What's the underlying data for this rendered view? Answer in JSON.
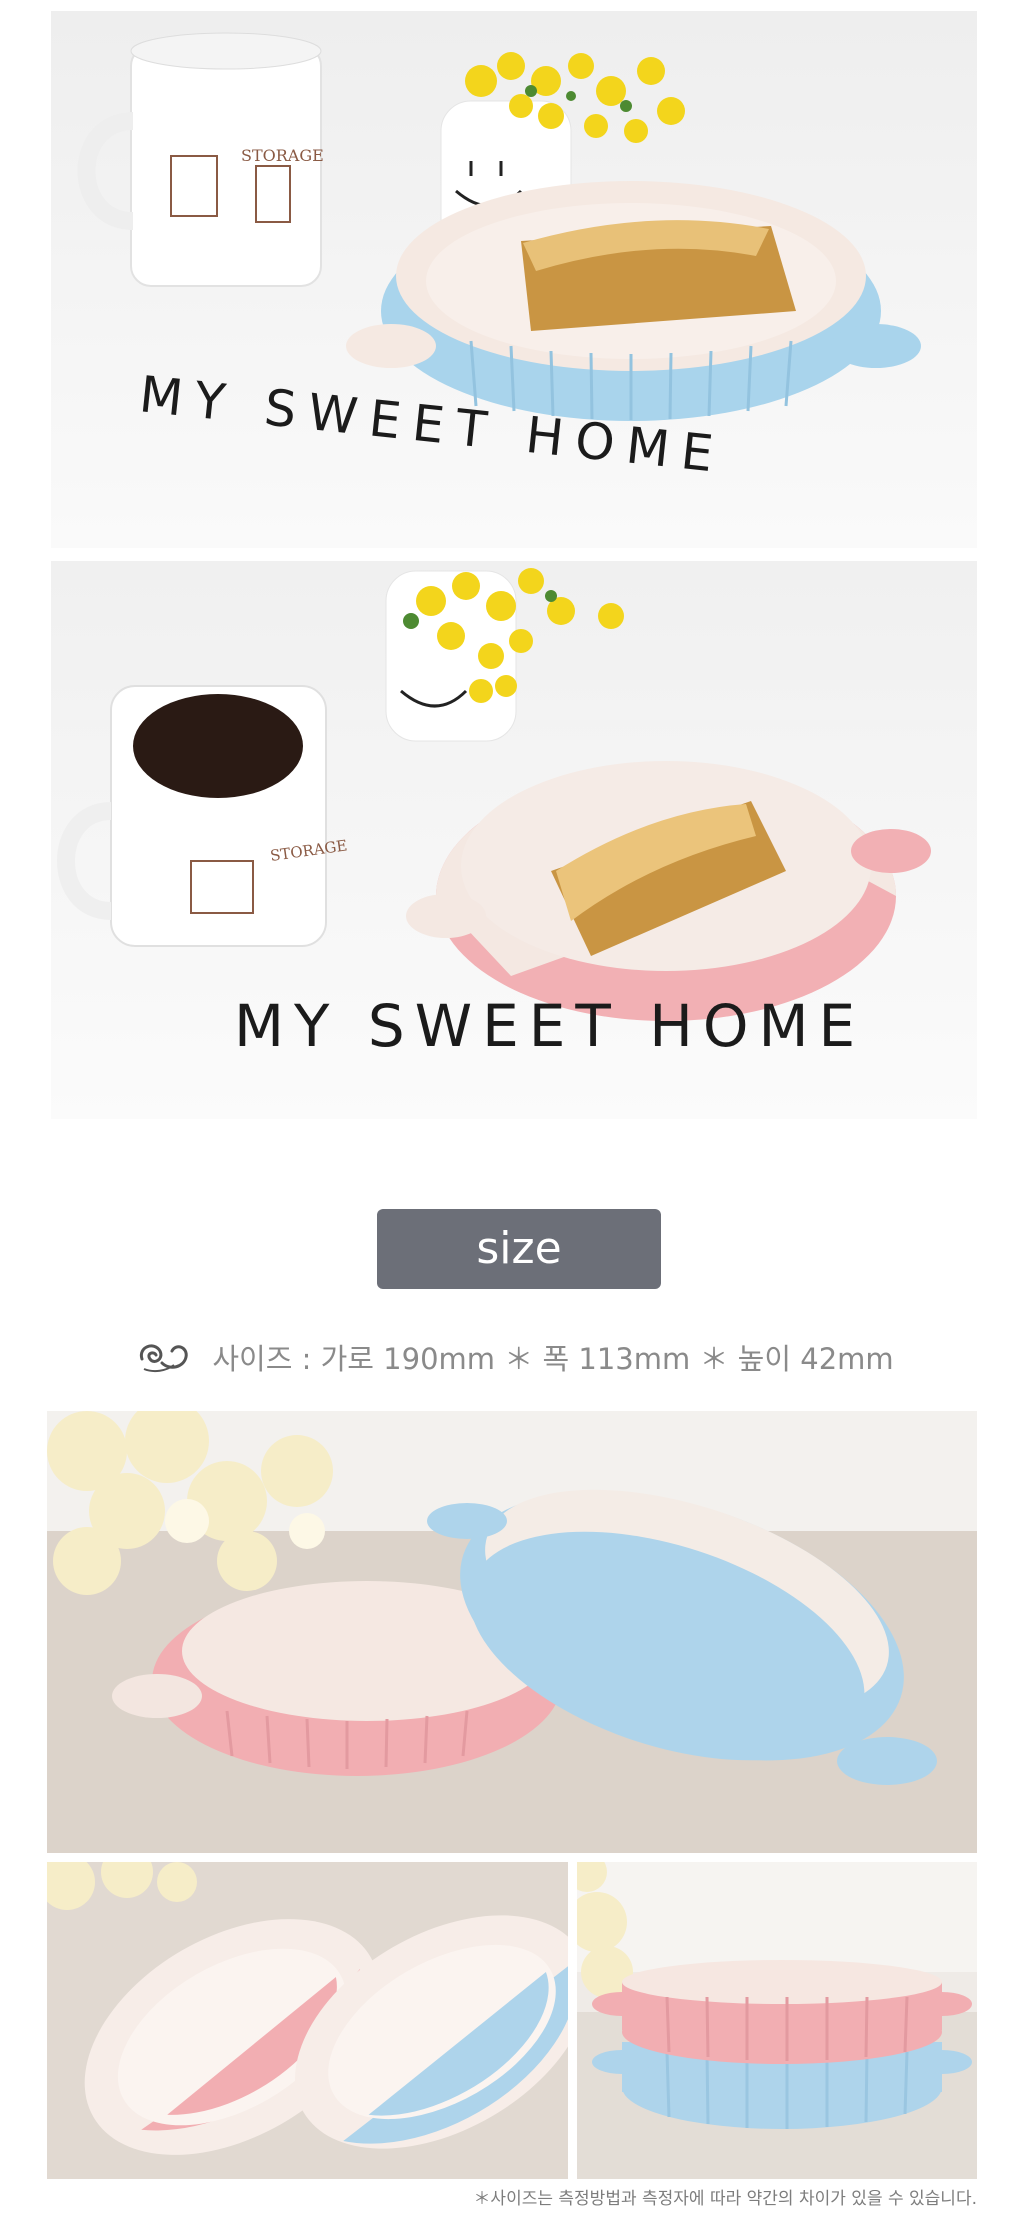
{
  "photos": [
    {
      "name": "bakeware-photo-blue-dish",
      "overlay_text": "MY SWEET HOME",
      "mug_label": "STORAGE"
    },
    {
      "name": "bakeware-photo-pink-dish",
      "overlay_text": "MY SWEET HOME",
      "mug_label": "STORAGE"
    },
    {
      "name": "bakeware-photo-pink-blue-pair"
    },
    {
      "name": "bakeware-photo-top-view"
    },
    {
      "name": "bakeware-photo-stacked"
    }
  ],
  "size_section": {
    "badge_label": "size",
    "ornament_icon": "floral-ornament-icon",
    "spec_text": "사이즈 : 가로 190mm  ＊ 폭 113mm ＊ 높이 42mm"
  },
  "footnote": "＊사이즈는 측정방법과 측정자에 따라 약간의 차이가 있을 수 있습니다.",
  "colors": {
    "badge_bg": "#6c6f78",
    "pastel_blue": "#a9d4ec",
    "pastel_pink": "#f2b0b4",
    "text_gray": "#8a8a8a"
  }
}
